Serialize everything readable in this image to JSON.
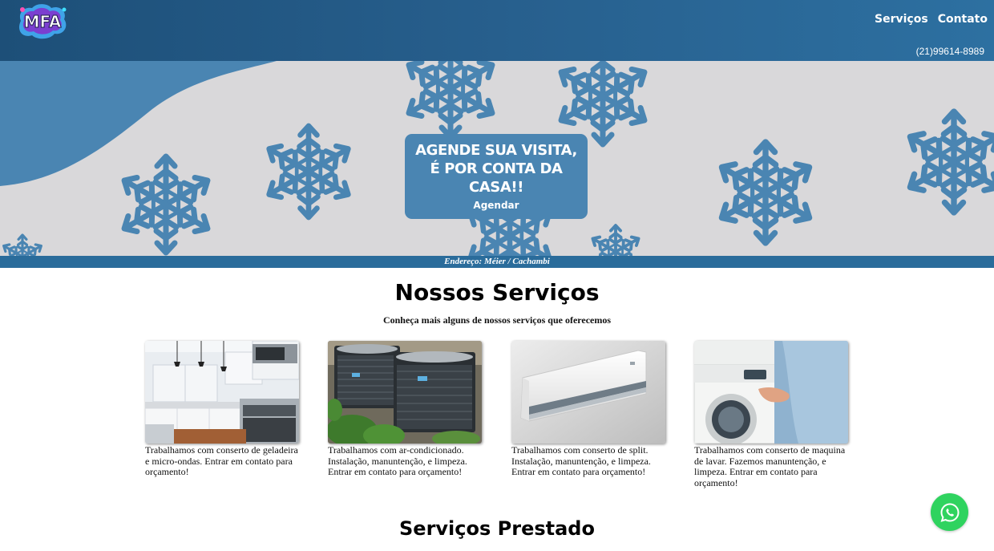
{
  "header": {
    "logo_text": "MFA",
    "nav": [
      {
        "label": "Serviços"
      },
      {
        "label": "Contato"
      }
    ],
    "phone": "(21)99614-8989"
  },
  "hero": {
    "cta_title": "AGENDE SUA VISITA, É POR CONTA DA CASA!!",
    "cta_button": "Agendar",
    "address": "Endereço: Méier / Cachambi"
  },
  "services": {
    "title": "Nossos Serviços",
    "subtitle": "Conheça mais alguns de nossos serviços que oferecemos",
    "cards": [
      {
        "icon": "kitchen-photo",
        "desc": "Trabalhamos com conserto de geladeira e micro-ondas. Entrar em contato para orçamento!"
      },
      {
        "icon": "ac-condenser-photo",
        "desc": "Trabalhamos com ar-condicionado. Instalação, manuntenção, e limpeza. Entrar em contato para orçamento!"
      },
      {
        "icon": "split-ac-photo",
        "desc": "Trabalhamos com conserto de split. Instalação, manuntenção, e limpeza. Entrar em contato para orçamento!"
      },
      {
        "icon": "washing-machine-photo",
        "desc": "Trabalhamos com conserto de maquina de lavar. Fazemos manuntenção, e limpeza. Entrar em contato para orçamento!"
      }
    ]
  },
  "provided": {
    "title": "Serviços Prestado"
  },
  "colors": {
    "header": "#275f8d",
    "hero_bg": "#d9d8da",
    "snowflake": "#4a85b2",
    "cta": "#4a85b2",
    "address_bar": "#2a6c9b",
    "whatsapp": "#2fd35f"
  }
}
